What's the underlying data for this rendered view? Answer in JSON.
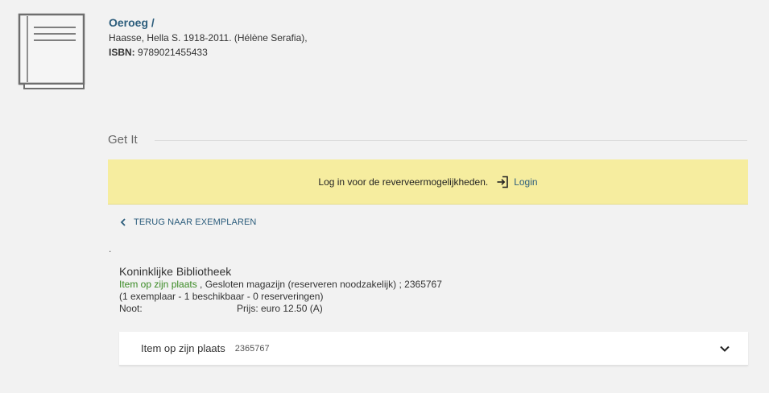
{
  "record": {
    "title": "Oeroeg /",
    "author": "Haasse, Hella S. 1918-2011. (Hélène Serafia),",
    "isbn_label": "ISBN:",
    "isbn_value": "9789021455433"
  },
  "getit": {
    "label": "Get It"
  },
  "login_banner": {
    "message": "Log in voor de reverveermogelijkheden.",
    "login_label": "Login"
  },
  "back": {
    "label": "TERUG NAAR EXEMPLAREN"
  },
  "separator_dot": ".",
  "location": {
    "library": "Koninklijke Bibliotheek",
    "status": "Item op zijn plaats",
    "detail": " , Gesloten magazijn (reserveren noodzakelijk) ; 2365767",
    "counts": "(1 exemplaar - 1 beschikbaar - 0 reserveringen)",
    "note_label": "Noot:",
    "note_value": "Prijs: euro 12.50 (A)"
  },
  "item": {
    "status": "Item op zijn plaats",
    "barcode": "2365767"
  },
  "colors": {
    "link": "#2c5d7c",
    "status_green": "#3a8a24",
    "banner_bg": "#f6ed9f",
    "page_bg": "#f2f2f2"
  }
}
